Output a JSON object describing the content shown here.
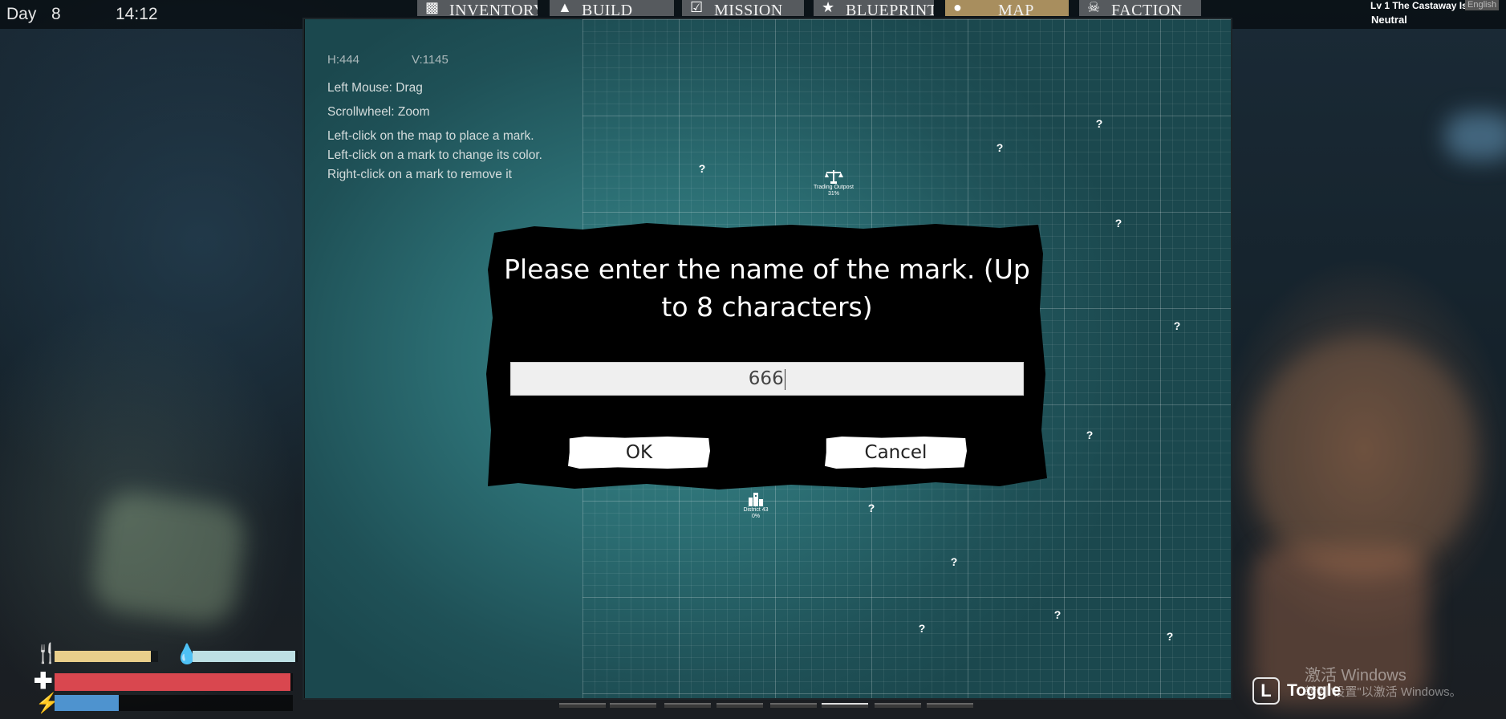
{
  "hud": {
    "day_label": "Day",
    "day_value": "8",
    "time": "14:12"
  },
  "tabs": [
    {
      "label": "INVENTORY",
      "icon": "inventory-icon",
      "active": false
    },
    {
      "label": "BUILD",
      "icon": "build-icon",
      "active": false
    },
    {
      "label": "MISSION",
      "icon": "mission-icon",
      "active": false
    },
    {
      "label": "BLUEPRINT",
      "icon": "blueprint-icon",
      "active": false
    },
    {
      "label": "MAP",
      "icon": "map-pin-icon",
      "active": true
    },
    {
      "label": "FACTION",
      "icon": "skull-icon",
      "active": false
    }
  ],
  "region": {
    "name": "Lv 1 The Castaway Is",
    "language": "English",
    "stance": "Neutral"
  },
  "map": {
    "h_label": "H:444",
    "v_label": "V:1145",
    "help": {
      "drag": "Left Mouse: Drag",
      "zoom": "Scrollwheel: Zoom",
      "place": "Left-click on the map to place a mark.",
      "color": "Left-click on a mark to change its color.",
      "remove": "Right-click on a mark to remove it"
    },
    "unknown_mark": "?",
    "locations": [
      {
        "name": "Trading Outpost",
        "progress": "31%",
        "icon": "scales-icon"
      },
      {
        "name": "District 43",
        "progress": "0%",
        "icon": "city-icon"
      }
    ]
  },
  "dialog": {
    "title": "Please enter the name of the mark. (Up to 8 characters)",
    "input_value": "666",
    "ok_label": "OK",
    "cancel_label": "Cancel"
  },
  "stats": {
    "food": 0.93,
    "water": 0.98,
    "health": 0.99,
    "stamina": 0.27,
    "food_color": "#e9cf8b",
    "water_color": "#bde0e4",
    "health_color": "#d9474f",
    "stamina_color": "#4e93cf"
  },
  "toggle": {
    "key": "L",
    "label": "Toggle"
  },
  "watermark": {
    "line1": "激活 Windows",
    "line2": "转到\"设置\"以激活 Windows。"
  }
}
